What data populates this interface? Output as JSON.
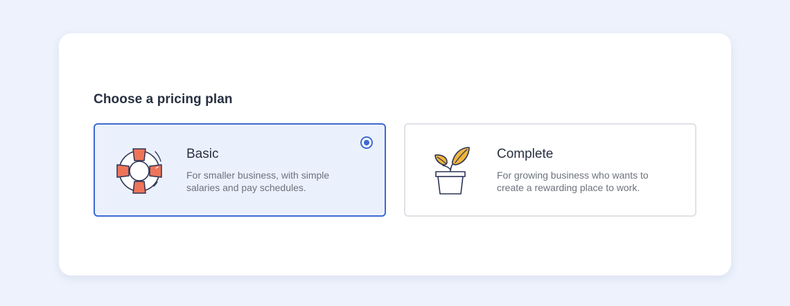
{
  "heading": "Choose a pricing plan",
  "plans": [
    {
      "title": "Basic",
      "description": "For smaller business, with simple salaries and pay schedules.",
      "icon": "lifebuoy-icon",
      "selected": true
    },
    {
      "title": "Complete",
      "description": "For growing business who wants to create a rewarding place to work.",
      "icon": "potted-plant-icon",
      "selected": false
    }
  ],
  "colors": {
    "accent": "#3d6ad0",
    "selected_background": "#ebf1fc",
    "lifebuoy_orange": "#ee7459",
    "plant_yellow": "#eeb53d",
    "icon_outline": "#2c3356"
  }
}
